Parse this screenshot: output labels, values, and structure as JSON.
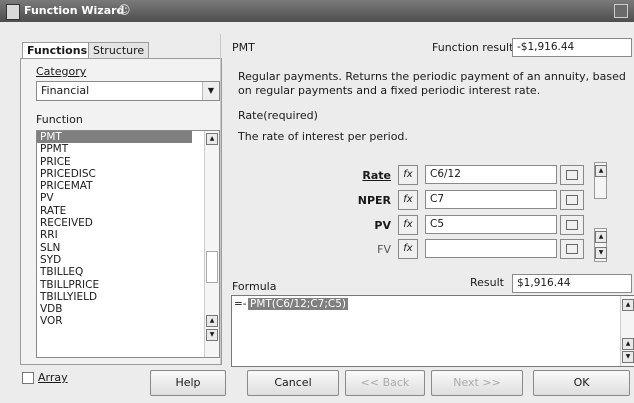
{
  "window": {
    "title": "Function Wizard",
    "title_symbol": "☺"
  },
  "tabs": [
    {
      "label": "Functions"
    },
    {
      "label": "Structure"
    }
  ],
  "category": {
    "label": "Category",
    "value": "Financial"
  },
  "function_list": {
    "label": "Function",
    "items": [
      "PMT",
      "PPMT",
      "PRICE",
      "PRICEDISC",
      "PRICEMAT",
      "PV",
      "RATE",
      "RECEIVED",
      "RRI",
      "SLN",
      "SYD",
      "TBILLEQ",
      "TBILLPRICE",
      "TBILLYIELD",
      "VDB",
      "VOR"
    ],
    "selected": "PMT"
  },
  "details": {
    "function_name": "PMT",
    "result_label": "Function result",
    "result_value": "-$1,916.44",
    "description": "Regular payments. Returns the periodic payment of an annuity, based on regular payments and a fixed periodic interest rate.",
    "arg_title": "Rate(required)",
    "arg_description": "The rate of interest per period."
  },
  "args": [
    {
      "label": "Rate",
      "value": "C6/12",
      "enabled": true
    },
    {
      "label": "NPER",
      "value": "C7",
      "enabled": true
    },
    {
      "label": "PV",
      "value": "C5",
      "enabled": true
    },
    {
      "label": "FV",
      "value": "",
      "enabled": false
    }
  ],
  "fx_glyph": "fx",
  "formula": {
    "label": "Formula",
    "result_label": "Result",
    "result_value": "$1,916.44",
    "prefix": "=-",
    "text": "PMT(C6/12;C7;C5)"
  },
  "array_label": "Array",
  "buttons": {
    "help": "Help",
    "cancel": "Cancel",
    "back": "<< Back",
    "next": "Next >>",
    "ok": "OK"
  }
}
